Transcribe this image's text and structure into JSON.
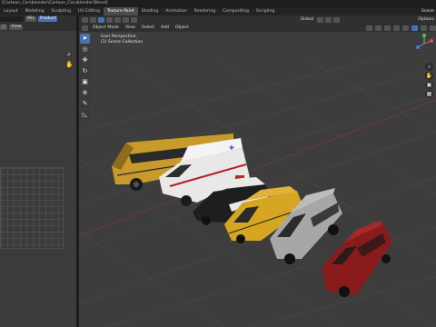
{
  "window": {
    "title": "[Cartoon_Carsblender\\Cartoon_Carsblender\\Blend]"
  },
  "tabs": [
    "Layout",
    "Modeling",
    "Sculpting",
    "UV Editing",
    "Texture Paint",
    "Shading",
    "Animation",
    "Rendering",
    "Compositing",
    "Scripting"
  ],
  "active_tab": "Texture Paint",
  "scene_label": "Scene",
  "left_panel": {
    "mode": "Mix",
    "new_button": "Product",
    "view_button": "View",
    "image_label": "Image*"
  },
  "viewport": {
    "mode": "Global",
    "object_mode": "Object Mode",
    "menu": [
      "View",
      "Select",
      "Add",
      "Object"
    ],
    "options": "Options",
    "info_line1": "User Perspective",
    "info_line2": "(1) Scene Collection"
  },
  "tools": [
    "cursor",
    "select",
    "move",
    "rotate",
    "scale",
    "transform",
    "annotate",
    "measure"
  ],
  "vehicles": [
    "school-bus",
    "ambulance",
    "police-car",
    "taxi",
    "suv",
    "sedan"
  ],
  "colors": {
    "bus": "#c89a2a",
    "taxi": "#d6a623",
    "suv": "#a7a7a7",
    "sedan": "#8a1b1c",
    "ambulance": "#e8e8e8",
    "police": "#1e1e1e",
    "accent": "#4772b3"
  }
}
